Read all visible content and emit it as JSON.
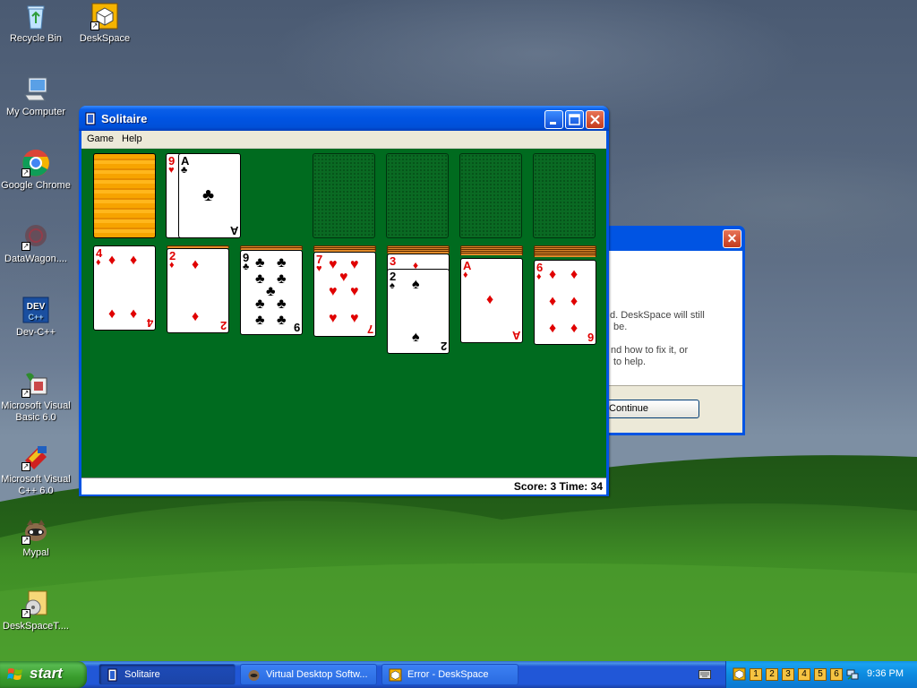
{
  "desktop": {
    "icons": [
      {
        "label": "Recycle Bin",
        "icon": "recycle-bin-icon"
      },
      {
        "label": "DeskSpace",
        "icon": "deskspace-icon"
      },
      {
        "label": "My Computer",
        "icon": "my-computer-icon"
      },
      {
        "label": "Google Chrome",
        "icon": "chrome-icon"
      },
      {
        "label": "DataWagon....",
        "icon": "datawagon-icon"
      },
      {
        "label": "Dev-C++",
        "icon": "dev-cpp-icon"
      },
      {
        "label": "Microsoft Visual Basic 6.0",
        "icon": "visual-basic-icon"
      },
      {
        "label": "Microsoft Visual C++ 6.0",
        "icon": "visual-cpp-icon"
      },
      {
        "label": "Mypal",
        "icon": "mypal-icon"
      },
      {
        "label": "DeskSpaceT....",
        "icon": "deskspace-trial-icon"
      }
    ]
  },
  "error_dialog": {
    "text_line1": "d. DeskSpace will still",
    "text_line2": "be.",
    "text_line3": "nd how to fix it, or",
    "text_line4": "to help.",
    "continue_label": "Continue"
  },
  "solitaire": {
    "title": "Solitaire",
    "menu": [
      "Game",
      "Help"
    ],
    "status": "Score: 3 Time: 34",
    "waste_cards": [
      {
        "rank": "9",
        "suit": "♥",
        "color": "red"
      },
      {
        "rank": "A",
        "suit": "♣",
        "color": "black"
      }
    ],
    "tableau": [
      {
        "rank": "4",
        "suit": "♦",
        "color": "red",
        "hidden": 0
      },
      {
        "rank": "2",
        "suit": "♦",
        "color": "red",
        "hidden": 1
      },
      {
        "rank": "9",
        "suit": "♣",
        "color": "black",
        "hidden": 2
      },
      {
        "rank": "7",
        "suit": "♥",
        "color": "red",
        "hidden": 3
      },
      {
        "rank": "2",
        "suit": "♠",
        "color": "black",
        "hidden": 4,
        "under": {
          "rank": "3",
          "suit": "♦",
          "color": "red"
        }
      },
      {
        "rank": "A",
        "suit": "♦",
        "color": "red",
        "hidden": 5
      },
      {
        "rank": "6",
        "suit": "♦",
        "color": "red",
        "hidden": 6
      }
    ]
  },
  "taskbar": {
    "start_label": "start",
    "tasks": [
      {
        "label": "Solitaire"
      },
      {
        "label": "Virtual Desktop Softw..."
      },
      {
        "label": "Error - DeskSpace"
      }
    ],
    "desktops": [
      "1",
      "2",
      "3",
      "4",
      "5",
      "6"
    ],
    "clock": "9:36 PM"
  }
}
